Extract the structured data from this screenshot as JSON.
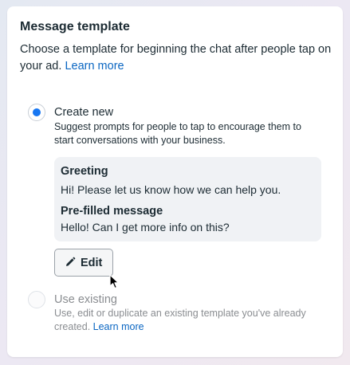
{
  "section": {
    "title": "Message template",
    "description": "Choose a template for beginning the chat after people tap on your ad.",
    "learn_more": "Learn more"
  },
  "options": {
    "create_new": {
      "label": "Create new",
      "description": "Suggest prompts for people to tap to encourage them to start conversations with your business.",
      "selected": true
    },
    "use_existing": {
      "label": "Use existing",
      "description": "Use, edit or duplicate an existing template you've already created.",
      "learn_more": "Learn more",
      "selected": false
    }
  },
  "preview": {
    "greeting_heading": "Greeting",
    "greeting_text": "Hi! Please let us know how we can help you.",
    "prefilled_heading": "Pre-filled message",
    "prefilled_text": "Hello! Can I get more info on this?"
  },
  "edit_button": {
    "label": "Edit",
    "icon": "pencil-icon"
  },
  "colors": {
    "accent": "#1877f2",
    "link": "#0a66c2",
    "preview_bg": "#f0f2f5",
    "disabled_text": "#8a8d91"
  }
}
